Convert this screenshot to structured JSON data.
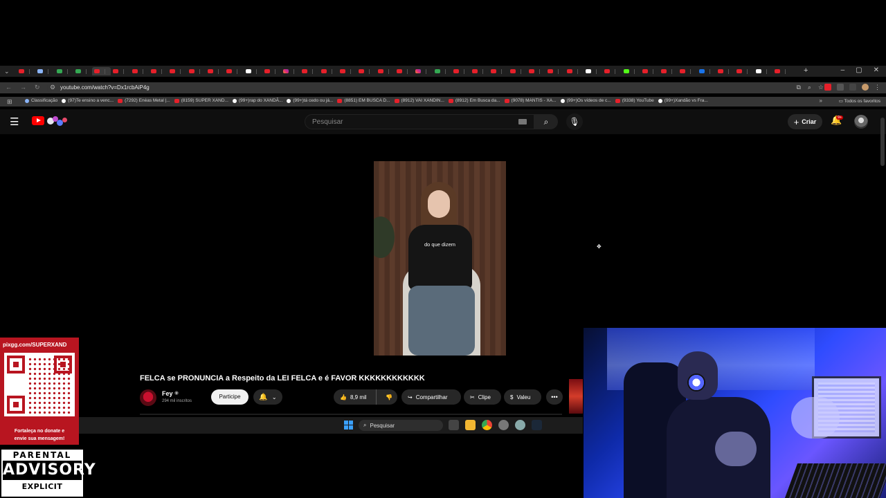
{
  "browser": {
    "url": "youtube.com/watch?v=Dx1rcbAiP4g",
    "tab_count": 41,
    "new_tab_symbol": "+",
    "window_controls": [
      "–",
      "▢",
      "✕"
    ],
    "bookmarks": [
      {
        "label": "Classificação",
        "icon": "cl"
      },
      {
        "label": "(97)Te ensino a venc...",
        "icon": "tk"
      },
      {
        "label": "(7292) Enéas Metal |...",
        "icon": "yt"
      },
      {
        "label": "(8159) SUPER XAND...",
        "icon": "yt"
      },
      {
        "label": "(99+)rap do XANDÃ...",
        "icon": "tk"
      },
      {
        "label": "(99+)tá cedo ou já...",
        "icon": "tk"
      },
      {
        "label": "(8851) EM BUSCA D...",
        "icon": "yt"
      },
      {
        "label": "(8912) VAI XANDIN...",
        "icon": "yt"
      },
      {
        "label": "(8912) Em Busca da...",
        "icon": "yt"
      },
      {
        "label": "(9078) MANTIS - XA...",
        "icon": "yt"
      },
      {
        "label": "(99+)Os vídeos de c...",
        "icon": "tk"
      },
      {
        "label": "(9338) YouTube",
        "icon": "yt"
      },
      {
        "label": "(99+)Xandão vs Fra...",
        "icon": "tk"
      }
    ],
    "favorites_label": "Todos os favoritos"
  },
  "youtube": {
    "search_placeholder": "Pesquisar",
    "create_label": "Criar",
    "notif_badge": "9+",
    "video_caption": "do que dizem",
    "title": "FELCA se PRONUNCIA a Respeito da LEI FELCA e é FAVOR KKKKKKKKKKKK",
    "channel_name": "Fey",
    "subscribers": "294 mil inscritos",
    "join_label": "Participe",
    "likes": "8,9 mil",
    "share_label": "Compartilhar",
    "clip_label": "Clipe",
    "thanks_label": "Valeu"
  },
  "taskbar": {
    "search_label": "Pesquisar"
  },
  "overlay": {
    "pix_url": "pixgg.com/SUPERXAND",
    "pix_message_line1": "Fortaleça no donate e",
    "pix_message_line2": "envie sua mensagem!",
    "advisory_top": "PARENTAL",
    "advisory_mid": "ADVISORY",
    "advisory_bottom": "EXPLICIT CONTENT"
  },
  "colors": {
    "youtube_red": "#ff0000",
    "pix_panel": "#b81520",
    "webcam_glow": "#2f4cff"
  }
}
